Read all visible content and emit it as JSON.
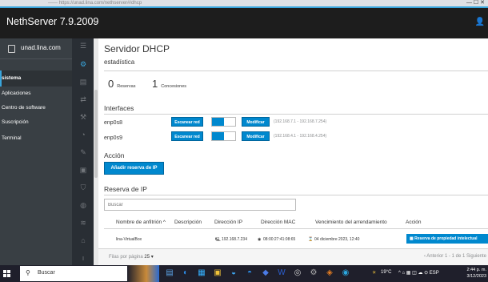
{
  "browser": {
    "url_blur": "—— https://unad.lina.com/nethserver#/dhcp",
    "controls": "—  ☐  ✕"
  },
  "app": {
    "title": "NethServer 7.9.2009",
    "user_glyph": "👤"
  },
  "sidebar": {
    "host": "unad.lina.com",
    "items": [
      {
        "label": "sistema",
        "active": true
      },
      {
        "label": "Aplicaciones"
      },
      {
        "label": "Centro de software"
      },
      {
        "label": "Suscripción"
      },
      {
        "label": "Terminal"
      }
    ],
    "icons": [
      "☰",
      "⚙",
      "▤",
      "⇄",
      "⚒",
      "◔",
      "✎",
      "▣",
      "⛉",
      "◍",
      "≋",
      "⌂",
      "ı"
    ]
  },
  "main": {
    "title": "Servidor DHCP",
    "stats_heading": "estadística",
    "stats": [
      {
        "value": "0",
        "label": "Reservas"
      },
      {
        "value": "1",
        "label": "Concesiones"
      }
    ],
    "interfaces_heading": "Interfaces",
    "interfaces": [
      {
        "name": "enp0s8",
        "scan": "Escanear red",
        "modify": "Modificar",
        "range": "(192.168.7.1 - 192.168.7.254)"
      },
      {
        "name": "enp0s9",
        "scan": "Escanear red",
        "modify": "Modificar",
        "range": "(192.168.4.1 - 192.168.4.254)"
      }
    ],
    "action_heading": "Acción",
    "reserve_button": "Añadir reserva de IP",
    "reservation_heading": "Reserva de IP",
    "search_placeholder": "Buscar",
    "table": {
      "headers": [
        "Nombre de anfitrión ^",
        "Descripción",
        "Dirección IP",
        "Dirección MAC",
        "Vencimiento del arrendamiento",
        "Acción"
      ],
      "row": {
        "host": "lina-VirtualBox",
        "ip_icon": "🖳",
        "ip": "192.168.7.234",
        "mac_icon": "◉",
        "mac": "08:00:27:41:08:65",
        "lease_icon": "⌛",
        "lease": "04 diciembre 2023, 12:40",
        "action_icon": "▦",
        "action": "Reserva de propiedad intelectual"
      }
    },
    "per_page_label": "Filas por página",
    "per_page_value": "25 ▾",
    "pager": "‹ Anterior   1 - 1 de 1   Siguiente"
  },
  "taskbar": {
    "search": "Buscar",
    "apps": [
      "▤",
      "◐",
      "▦",
      "▣",
      "◒",
      "◓",
      "◆",
      "W",
      "◎",
      "⚙",
      "◈",
      "◉"
    ],
    "app_colors": [
      "#5ba3e6",
      "#2b8be6",
      "#35b1ff",
      "#f0c239",
      "#3da8f5",
      "#2b8be6",
      "#4b7be6",
      "#2b5fd1",
      "#cfcfcf",
      "#aaaaaa",
      "#e67e22",
      "#2ca7df"
    ],
    "weather": "19°C",
    "tray": "^ ⌂ ▦ ◫ ☁ ⊙ ESP",
    "time": "2:44 p. m.",
    "date": "3/12/2023"
  }
}
